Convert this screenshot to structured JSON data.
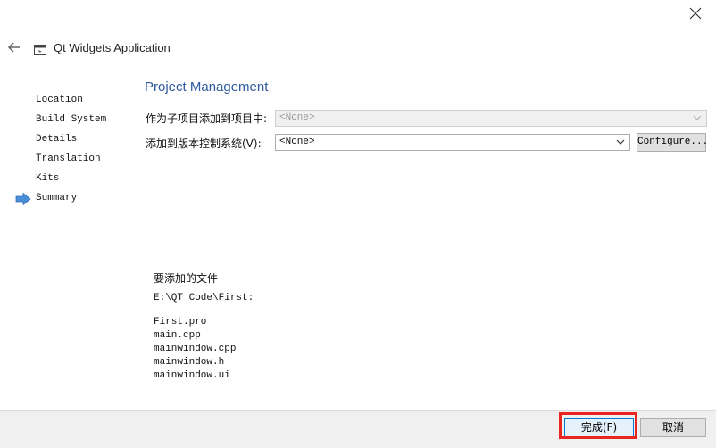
{
  "window": {
    "title": "Qt Widgets Application"
  },
  "steps": [
    "Location",
    "Build System",
    "Details",
    "Translation",
    "Kits",
    "Summary"
  ],
  "current_step": "Summary",
  "page": {
    "title": "Project Management",
    "subproject_label": "作为子项目添加到项目中:",
    "subproject_value": "<None>",
    "vcs_label": "添加到版本控制系统(V):",
    "vcs_value": "<None>",
    "configure_label": "Configure..."
  },
  "files": {
    "heading": "要添加的文件",
    "directory": "E:\\QT Code\\First:",
    "list": [
      "First.pro",
      "main.cpp",
      "mainwindow.cpp",
      "mainwindow.h",
      "mainwindow.ui"
    ]
  },
  "footer": {
    "finish_label": "完成(F)",
    "cancel_label": "取消"
  },
  "colors": {
    "title_blue": "#2d5aa0",
    "arrow_blue": "#4a8ed8",
    "highlight_red": "#e8251f"
  }
}
